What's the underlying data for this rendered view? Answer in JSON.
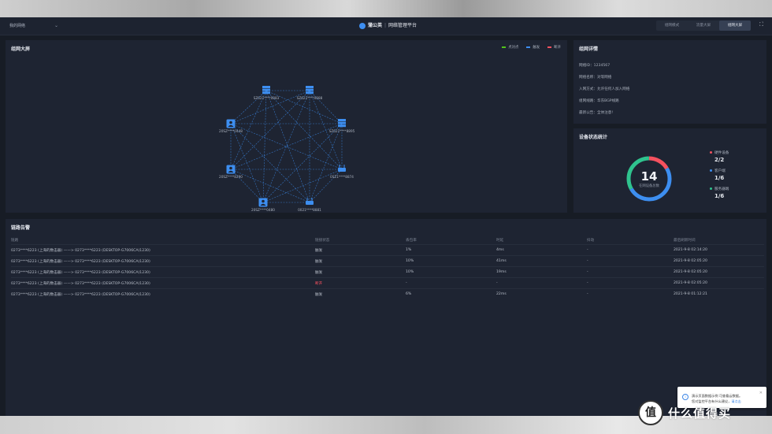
{
  "header": {
    "network_select": "我的网络",
    "brand_name": "蒲公英",
    "brand_sub": "网络管理平台",
    "modes": [
      "组网模式",
      "流量大屏",
      "组网大屏"
    ],
    "active_mode_index": 2
  },
  "topology": {
    "title": "组网大屏",
    "legend": [
      {
        "label": "点对点",
        "color": "#52c41a"
      },
      {
        "label": "触发",
        "color": "#3d8ef0"
      },
      {
        "label": "断开",
        "color": "#f5515f"
      }
    ],
    "nodes": [
      {
        "label": "SZ621****0883",
        "icon": "server-icon"
      },
      {
        "label": "SZ621****0888",
        "icon": "server-icon"
      },
      {
        "label": "SZ621****8895",
        "icon": "server-icon"
      },
      {
        "label": "0SZ1****8874",
        "icon": "router-icon"
      },
      {
        "label": "0021****8881",
        "icon": "router-icon"
      },
      {
        "label": "20SZ****0448",
        "icon": "user-icon"
      },
      {
        "label": "20SZ****8290",
        "icon": "user-icon"
      },
      {
        "label": "20SZ****0480",
        "icon": "user-icon"
      }
    ]
  },
  "details": {
    "title": "组网详情",
    "rows": [
      "网络ID：1234567",
      "网络名称：对等网络",
      "入网方式：允许任何人加入网络",
      "组网线路：华东BGP线路",
      "最新公告：全体注意!"
    ]
  },
  "stats": {
    "title": "设备状态统计",
    "total": "14",
    "total_label": "在网设备总数",
    "segments": [
      {
        "label": "硬件设备",
        "value": "2/2",
        "color": "#f5515f"
      },
      {
        "label": "客户端",
        "value": "1/6",
        "color": "#3d8ef0"
      },
      {
        "label": "服务器端",
        "value": "1/6",
        "color": "#2fc38e"
      }
    ]
  },
  "alerts": {
    "title": "链路告警",
    "columns": [
      "链路",
      "链接状态",
      "丢包率",
      "时延",
      "抖动",
      "最后刷新时间"
    ],
    "rows": [
      {
        "link": "0273****6223 (上海的数击器) ——> 0273****6223 (DESKTOP-G7006CA)1230)",
        "status": "触发",
        "loss": "1%",
        "latency": "4ms",
        "jitter": "-",
        "time": "2021-9-8 02:14:20"
      },
      {
        "link": "0273****6223 (上海的数击器) ——> 0273****6223 (DESKTOP-G7006CA)1230)",
        "status": "触发",
        "loss": "10%",
        "latency": "41ms",
        "jitter": "-",
        "time": "2021-9-8 02:05:20"
      },
      {
        "link": "0273****6223 (上海的数击器) ——> 0273****6223 (DESKTOP-G7006CA)1230)",
        "status": "触发",
        "loss": "10%",
        "latency": "19ms",
        "jitter": "-",
        "time": "2021-9-8 02:05:20"
      },
      {
        "link": "0273****6223 (上海的数击器) ——> 0273****6223 (DESKTOP-G7006CA)1230)",
        "status": "断开",
        "loss": "-",
        "latency": "-",
        "jitter": "-",
        "time": "2021-9-8 02:05:20"
      },
      {
        "link": "0273****6223 (上海的数击器) ——> 0273****6223 (DESKTOP-G7006CA)1230)",
        "status": "触发",
        "loss": "6%",
        "latency": "22ms",
        "jitter": "-",
        "time": "2021-9-8 01:12:21"
      }
    ]
  },
  "toast": {
    "line1": "演示页面数据示例 可查看云数据。",
    "line2_prefix": "您对监控平台有什么建议，",
    "line2_link": "请点击"
  },
  "watermark": {
    "badge": "值",
    "text": "什么值得买"
  }
}
